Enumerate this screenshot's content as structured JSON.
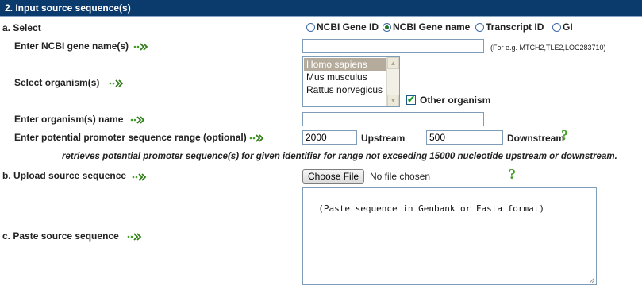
{
  "header": {
    "title": "2. Input source sequence(s)"
  },
  "select": {
    "label": "a. Select",
    "options": [
      {
        "label": "NCBI Gene ID",
        "checked": false
      },
      {
        "label": "NCBI Gene name",
        "checked": true
      },
      {
        "label": "Transcript ID",
        "checked": false
      },
      {
        "label": "GI",
        "checked": false
      }
    ]
  },
  "gene_names": {
    "label": "Enter NCBI gene name(s)",
    "value": "",
    "hint": "(For e.g. MTCH2,TLE2,LOC283710)"
  },
  "organism": {
    "label": "Select organism(s)",
    "options": [
      "Homo sapiens",
      "Mus musculus",
      "Rattus norvegicus"
    ],
    "selected": "Homo sapiens",
    "other_label": "Other organism",
    "other_checked": true
  },
  "organism_name": {
    "label": "Enter organism(s) name",
    "value": ""
  },
  "promoter": {
    "label": "Enter potential promoter sequence range (optional)",
    "upstream_value": "2000",
    "upstream_label": "Upstream",
    "downstream_value": "500",
    "downstream_label": "Downstream",
    "note": "retrieves potential promoter sequence(s) for given identifier for range not exceeding 15000 nucleotide upstream or downstream."
  },
  "upload": {
    "label": "b. Upload source sequence",
    "button": "Choose File",
    "status": "No file chosen"
  },
  "paste": {
    "label": "c. Paste source sequence",
    "value": "(Paste sequence in Genbank or Fasta format)"
  },
  "colors": {
    "header_bg": "#0b3a6c",
    "accent_green": "#3f9d1f"
  },
  "icons": {
    "arrow": "double-chevron-arrow-icon",
    "help": "question-mark-icon"
  }
}
